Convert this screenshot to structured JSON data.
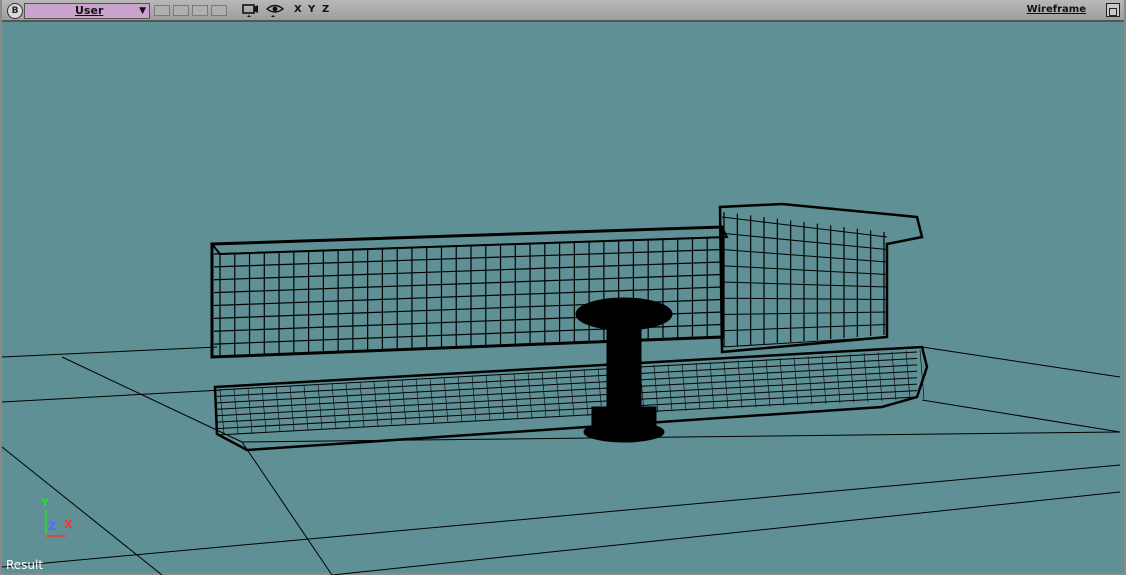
{
  "toolbar": {
    "b_button": "B",
    "view": "User",
    "view_arrow": "▼",
    "camera_icon": "camera-icon",
    "eye_icon": "eye-icon",
    "axis_x": "X",
    "axis_y": "Y",
    "axis_z": "Z",
    "shading": "Wireframe"
  },
  "viewport": {
    "background": "#5e9095",
    "status_label": "Result"
  },
  "axis_gizmo": {
    "y": "Y",
    "z": "Z",
    "x": "X",
    "colors": {
      "x": "#ff3030",
      "y": "#2bdc2b",
      "z": "#4a6cff"
    }
  }
}
